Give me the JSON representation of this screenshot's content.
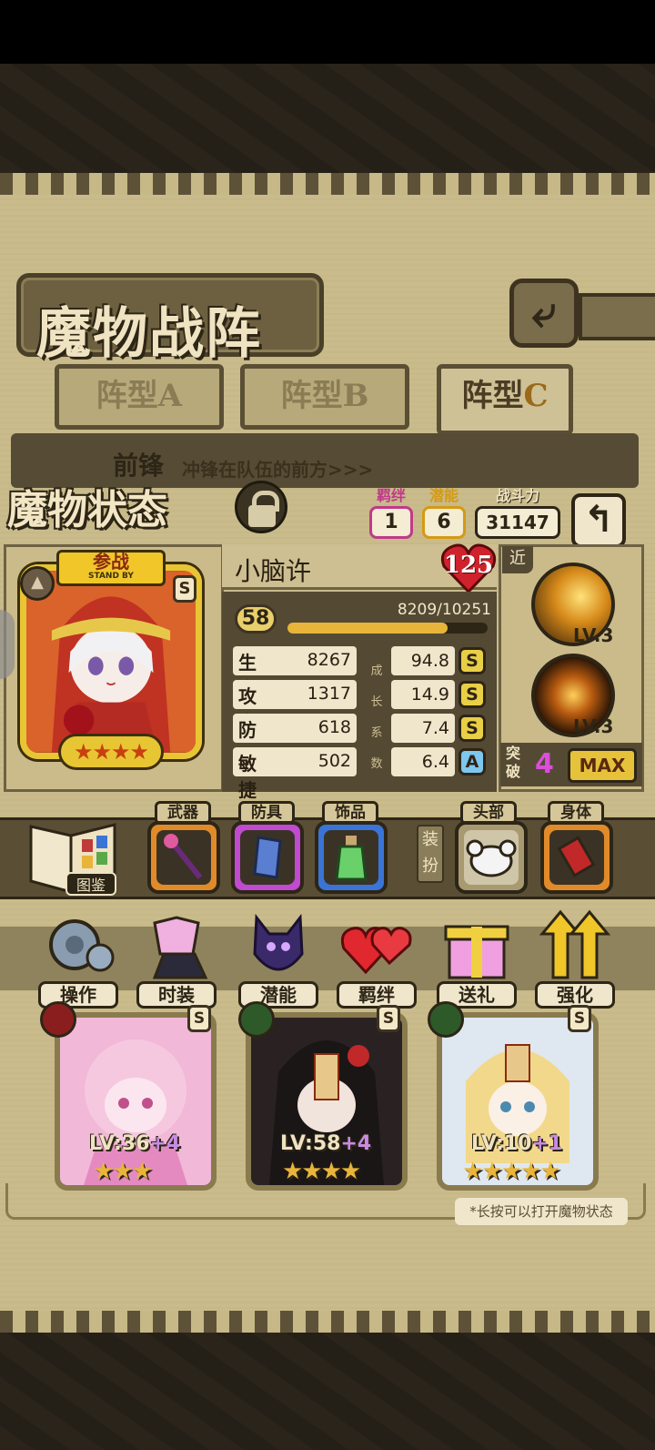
{
  "page": {
    "title": "魔物战阵",
    "back_icon": "back-arrow-icon"
  },
  "formation": {
    "tabs": [
      {
        "label": "阵型A",
        "active": false
      },
      {
        "label": "阵型B",
        "active": false
      },
      {
        "label": "阵型C",
        "active": true
      }
    ],
    "tab_c_prefix": "阵型",
    "tab_c_letter": "C",
    "vanguard_title": "前锋",
    "vanguard_desc": "冲锋在队伍的前方>>>"
  },
  "status": {
    "title": "魔物状态",
    "lock_icon": "lock-icon",
    "bond": {
      "label": "羁绊",
      "value": "1"
    },
    "potential": {
      "label": "潜能",
      "value": "6"
    },
    "power": {
      "label": "战斗力",
      "value": "31147"
    }
  },
  "character": {
    "name": "小脑许",
    "heart_level": "125",
    "standby_cn": "参战",
    "standby_en": "STAND BY",
    "rank": "S",
    "level": "58",
    "exp_text": "8209/10251",
    "exp_fraction": 0.8,
    "stars_text": "★★★★",
    "stats": [
      {
        "label": "生命",
        "value": "8267",
        "growth": "94.8",
        "grade": "S"
      },
      {
        "label": "攻击",
        "value": "1317",
        "growth": "14.9",
        "grade": "S"
      },
      {
        "label": "防御",
        "value": "618",
        "growth": "7.4",
        "grade": "S"
      },
      {
        "label": "敏捷",
        "value": "502",
        "growth": "6.4",
        "grade": "A"
      }
    ],
    "growth_label_chars": [
      "成",
      "长",
      "系",
      "数"
    ]
  },
  "skills": {
    "range_tag": "近",
    "items": [
      {
        "lv": "LV.3"
      },
      {
        "lv": "LV.3"
      }
    ],
    "breakthrough_label": "突破",
    "breakthrough_value": "4",
    "max_label": "MAX"
  },
  "equipment": {
    "codex_label": "图鉴",
    "dress_tag": "装扮",
    "slots": [
      {
        "label": "武器",
        "color": "#e08a2a"
      },
      {
        "label": "防具",
        "color": "#c04ad0"
      },
      {
        "label": "饰品",
        "color": "#3a74d6"
      },
      {
        "label": "头部",
        "color": "#a89a70"
      },
      {
        "label": "身体",
        "color": "#e08a2a"
      }
    ]
  },
  "actions": [
    {
      "label": "操作",
      "icon": "gear-icon"
    },
    {
      "label": "时装",
      "icon": "outfit-icon"
    },
    {
      "label": "潜能",
      "icon": "demon-icon"
    },
    {
      "label": "羁绊",
      "icon": "hearts-icon"
    },
    {
      "label": "送礼",
      "icon": "gift-icon"
    },
    {
      "label": "强化",
      "icon": "upgrade-arrows-icon"
    }
  ],
  "team": [
    {
      "lv": "LV:36",
      "plus": "+4",
      "stars": "★★★",
      "rank": "S",
      "element": "fire-icon"
    },
    {
      "lv": "LV:58",
      "plus": "+4",
      "stars": "★★★★",
      "rank": "S",
      "element": "leaf-icon"
    },
    {
      "lv": "LV:10",
      "plus": "+1",
      "stars": "★★★★★",
      "rank": "S",
      "element": "leaf-icon"
    }
  ],
  "hint": "*长按可以打开魔物状态"
}
